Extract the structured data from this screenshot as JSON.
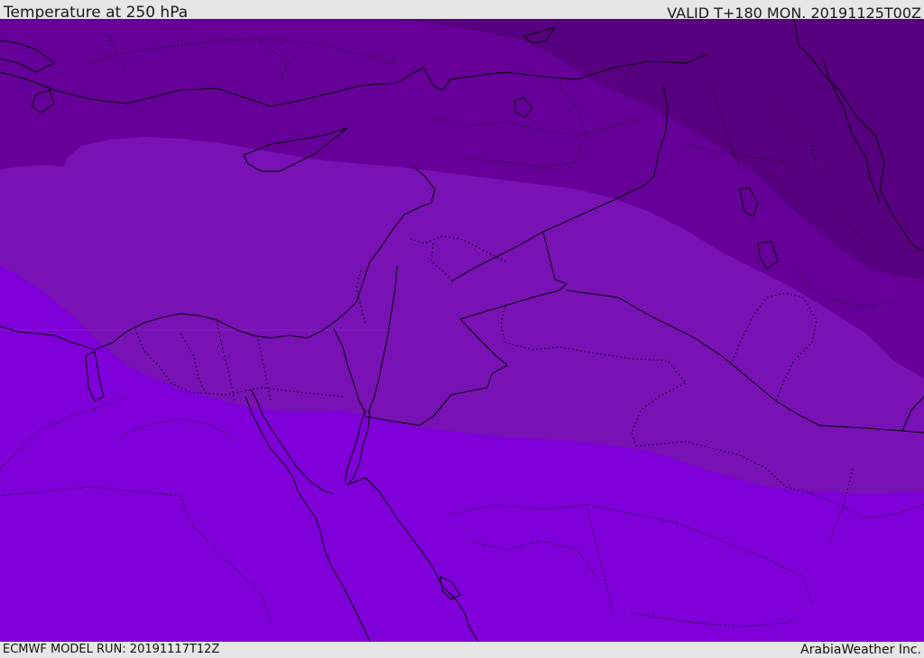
{
  "header": {
    "title": "Temperature at 250 hPa",
    "valid": "VALID T+180 MON. 20191125T00Z"
  },
  "footer": {
    "model_run": "ECMWF MODEL RUN: 20191117T12Z",
    "credit": "ArabiaWeather Inc."
  },
  "map": {
    "field": "temperature",
    "level": "250 hPa",
    "bands": [
      {
        "name": "coldest",
        "color": "#570080"
      },
      {
        "name": "cold",
        "color": "#660099"
      },
      {
        "name": "mid",
        "color": "#7812b4"
      },
      {
        "name": "warm",
        "color": "#7f00d9"
      }
    ],
    "boundary_color": "#000000"
  }
}
